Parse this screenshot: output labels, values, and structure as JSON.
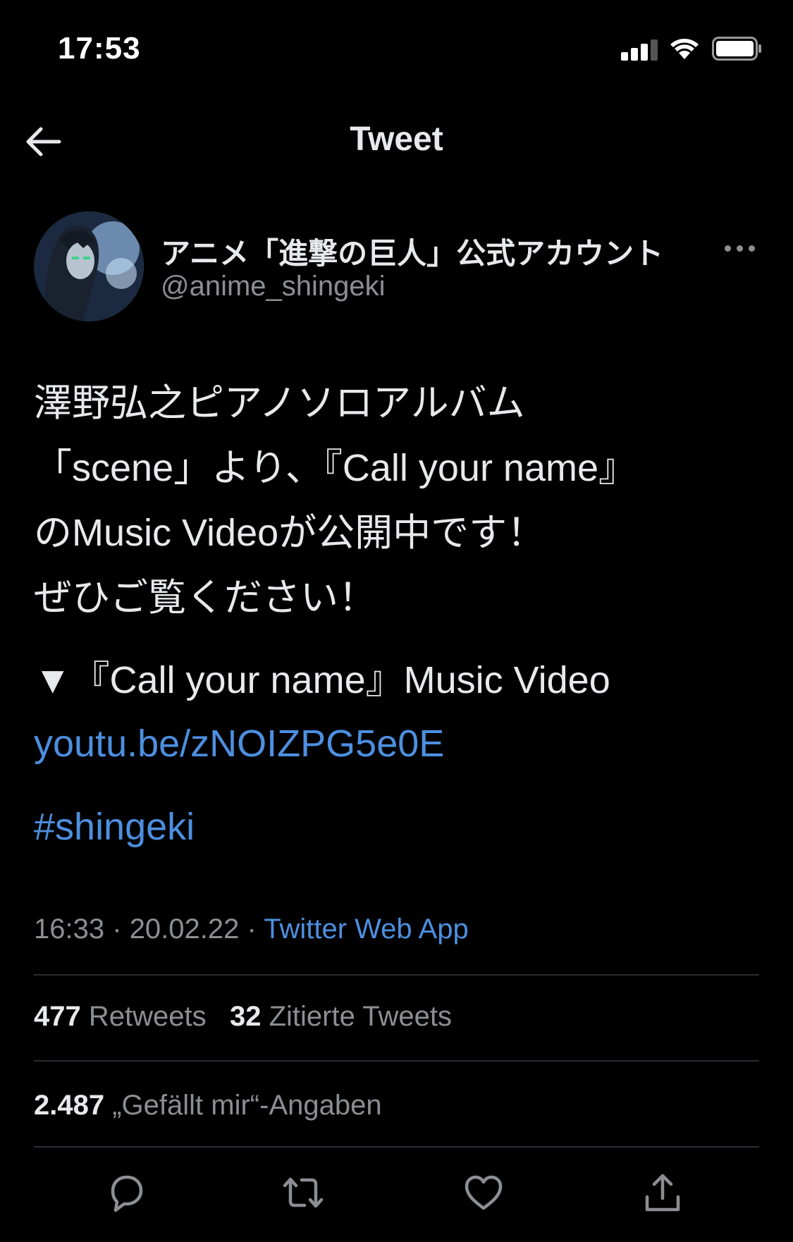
{
  "status_bar": {
    "time": "17:53"
  },
  "nav": {
    "title": "Tweet",
    "back_icon": "arrow-left-icon"
  },
  "author": {
    "display_name": "アニメ「進撃の巨人」公式アカウント",
    "handle": "@anime_shingeki"
  },
  "tweet": {
    "lines": [
      "澤野弘之ピアノソロアルバム",
      "「scene」より、『Call your name』",
      "のMusic Videoが公開中です！",
      "ぜひご覧ください！"
    ],
    "video_line": "▼『Call your name』Music Video",
    "link": "youtu.be/zNOIZPG5e0E",
    "hashtag": "#shingeki"
  },
  "meta": {
    "time": "16:33",
    "date": "20.02.22",
    "separator": "·",
    "source": "Twitter Web App"
  },
  "stats": {
    "retweets_count": "477",
    "retweets_label": "Retweets",
    "quotes_count": "32",
    "quotes_label": "Zitierte Tweets",
    "likes_count": "2.487",
    "likes_label": "„Gefällt mir“-Angaben"
  },
  "actions": [
    "reply-icon",
    "retweet-icon",
    "like-icon",
    "share-icon"
  ],
  "colors": {
    "background": "#000000",
    "text": "#e7e9ea",
    "secondary": "#8b8f94",
    "link": "#4d8fe0",
    "divider": "#2a2d31"
  }
}
